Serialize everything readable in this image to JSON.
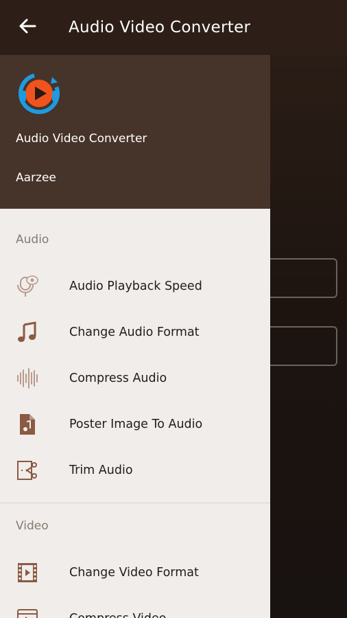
{
  "appbar": {
    "title": "Audio Video Converter"
  },
  "drawer": {
    "header": {
      "app_name": "Audio Video Converter",
      "user": "Aarzee"
    },
    "sections": [
      {
        "label": "Audio",
        "items": [
          {
            "label": "Audio Playback Speed",
            "icon": "microphone-speed-icon"
          },
          {
            "label": "Change Audio Format",
            "icon": "music-note-icon"
          },
          {
            "label": "Compress Audio",
            "icon": "waveform-icon"
          },
          {
            "label": "Poster Image To Audio",
            "icon": "audio-file-icon"
          },
          {
            "label": "Trim Audio",
            "icon": "scissors-trim-icon"
          }
        ]
      },
      {
        "label": "Video",
        "items": [
          {
            "label": "Change Video Format",
            "icon": "film-icon"
          },
          {
            "label": "Compress Video",
            "icon": "video-compress-icon"
          }
        ]
      }
    ]
  },
  "colors": {
    "appbar": "#2d1f17",
    "drawer_header": "#46332a",
    "drawer_bg": "#f1edea",
    "icon_accent": "#8a5a44",
    "logo_blue": "#1e9be0",
    "logo_orange": "#f0541e"
  }
}
